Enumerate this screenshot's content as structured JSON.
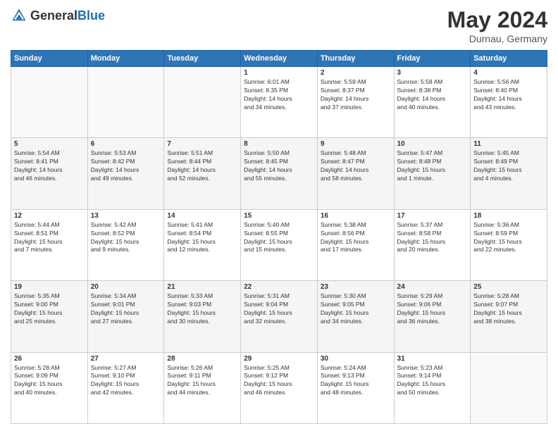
{
  "header": {
    "logo_general": "General",
    "logo_blue": "Blue",
    "month_title": "May 2024",
    "location": "Durnau, Germany"
  },
  "calendar": {
    "days_of_week": [
      "Sunday",
      "Monday",
      "Tuesday",
      "Wednesday",
      "Thursday",
      "Friday",
      "Saturday"
    ],
    "weeks": [
      [
        {
          "day": "",
          "info": ""
        },
        {
          "day": "",
          "info": ""
        },
        {
          "day": "",
          "info": ""
        },
        {
          "day": "1",
          "info": "Sunrise: 6:01 AM\nSunset: 8:35 PM\nDaylight: 14 hours\nand 34 minutes."
        },
        {
          "day": "2",
          "info": "Sunrise: 5:59 AM\nSunset: 8:37 PM\nDaylight: 14 hours\nand 37 minutes."
        },
        {
          "day": "3",
          "info": "Sunrise: 5:58 AM\nSunset: 8:38 PM\nDaylight: 14 hours\nand 40 minutes."
        },
        {
          "day": "4",
          "info": "Sunrise: 5:56 AM\nSunset: 8:40 PM\nDaylight: 14 hours\nand 43 minutes."
        }
      ],
      [
        {
          "day": "5",
          "info": "Sunrise: 5:54 AM\nSunset: 8:41 PM\nDaylight: 14 hours\nand 46 minutes."
        },
        {
          "day": "6",
          "info": "Sunrise: 5:53 AM\nSunset: 8:42 PM\nDaylight: 14 hours\nand 49 minutes."
        },
        {
          "day": "7",
          "info": "Sunrise: 5:51 AM\nSunset: 8:44 PM\nDaylight: 14 hours\nand 52 minutes."
        },
        {
          "day": "8",
          "info": "Sunrise: 5:50 AM\nSunset: 8:45 PM\nDaylight: 14 hours\nand 55 minutes."
        },
        {
          "day": "9",
          "info": "Sunrise: 5:48 AM\nSunset: 8:47 PM\nDaylight: 14 hours\nand 58 minutes."
        },
        {
          "day": "10",
          "info": "Sunrise: 5:47 AM\nSunset: 8:48 PM\nDaylight: 15 hours\nand 1 minute."
        },
        {
          "day": "11",
          "info": "Sunrise: 5:45 AM\nSunset: 8:49 PM\nDaylight: 15 hours\nand 4 minutes."
        }
      ],
      [
        {
          "day": "12",
          "info": "Sunrise: 5:44 AM\nSunset: 8:51 PM\nDaylight: 15 hours\nand 7 minutes."
        },
        {
          "day": "13",
          "info": "Sunrise: 5:42 AM\nSunset: 8:52 PM\nDaylight: 15 hours\nand 9 minutes."
        },
        {
          "day": "14",
          "info": "Sunrise: 5:41 AM\nSunset: 8:54 PM\nDaylight: 15 hours\nand 12 minutes."
        },
        {
          "day": "15",
          "info": "Sunrise: 5:40 AM\nSunset: 8:55 PM\nDaylight: 15 hours\nand 15 minutes."
        },
        {
          "day": "16",
          "info": "Sunrise: 5:38 AM\nSunset: 8:56 PM\nDaylight: 15 hours\nand 17 minutes."
        },
        {
          "day": "17",
          "info": "Sunrise: 5:37 AM\nSunset: 8:58 PM\nDaylight: 15 hours\nand 20 minutes."
        },
        {
          "day": "18",
          "info": "Sunrise: 5:36 AM\nSunset: 8:59 PM\nDaylight: 15 hours\nand 22 minutes."
        }
      ],
      [
        {
          "day": "19",
          "info": "Sunrise: 5:35 AM\nSunset: 9:00 PM\nDaylight: 15 hours\nand 25 minutes."
        },
        {
          "day": "20",
          "info": "Sunrise: 5:34 AM\nSunset: 9:01 PM\nDaylight: 15 hours\nand 27 minutes."
        },
        {
          "day": "21",
          "info": "Sunrise: 5:33 AM\nSunset: 9:03 PM\nDaylight: 15 hours\nand 30 minutes."
        },
        {
          "day": "22",
          "info": "Sunrise: 5:31 AM\nSunset: 9:04 PM\nDaylight: 15 hours\nand 32 minutes."
        },
        {
          "day": "23",
          "info": "Sunrise: 5:30 AM\nSunset: 9:05 PM\nDaylight: 15 hours\nand 34 minutes."
        },
        {
          "day": "24",
          "info": "Sunrise: 5:29 AM\nSunset: 9:06 PM\nDaylight: 15 hours\nand 36 minutes."
        },
        {
          "day": "25",
          "info": "Sunrise: 5:28 AM\nSunset: 9:07 PM\nDaylight: 15 hours\nand 38 minutes."
        }
      ],
      [
        {
          "day": "26",
          "info": "Sunrise: 5:28 AM\nSunset: 9:09 PM\nDaylight: 15 hours\nand 40 minutes."
        },
        {
          "day": "27",
          "info": "Sunrise: 5:27 AM\nSunset: 9:10 PM\nDaylight: 15 hours\nand 42 minutes."
        },
        {
          "day": "28",
          "info": "Sunrise: 5:26 AM\nSunset: 9:11 PM\nDaylight: 15 hours\nand 44 minutes."
        },
        {
          "day": "29",
          "info": "Sunrise: 5:25 AM\nSunset: 9:12 PM\nDaylight: 15 hours\nand 46 minutes."
        },
        {
          "day": "30",
          "info": "Sunrise: 5:24 AM\nSunset: 9:13 PM\nDaylight: 15 hours\nand 48 minutes."
        },
        {
          "day": "31",
          "info": "Sunrise: 5:23 AM\nSunset: 9:14 PM\nDaylight: 15 hours\nand 50 minutes."
        },
        {
          "day": "",
          "info": ""
        }
      ]
    ]
  }
}
